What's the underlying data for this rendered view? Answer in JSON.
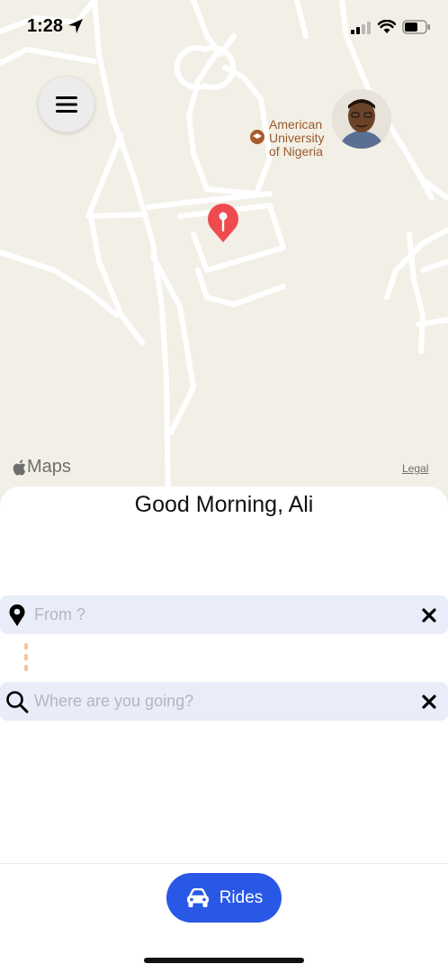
{
  "status_bar": {
    "time": "1:28"
  },
  "map": {
    "poi_label": "American\nUniversity\nof Nigeria",
    "attribution": "Maps",
    "legal": "Legal"
  },
  "sheet": {
    "greeting": "Good Morning, Ali",
    "from_field": {
      "placeholder": "From ?",
      "value": ""
    },
    "to_field": {
      "placeholder": "Where are you going?",
      "value": ""
    },
    "rides_label": "Rides"
  },
  "colors": {
    "accent": "#2a58e6",
    "field_bg": "#e9edf9",
    "pin": "#ef4b4f",
    "map_bg": "#f2efe6"
  }
}
